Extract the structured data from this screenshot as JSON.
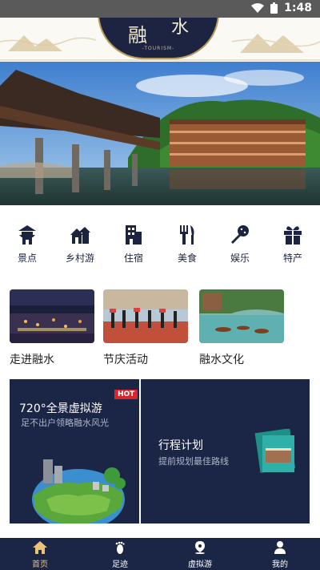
{
  "status_bar": {
    "time": "1:48"
  },
  "header": {
    "logo_char_1": "融",
    "logo_char_2": "水",
    "logo_sub": "-TOURISM-"
  },
  "categories": [
    {
      "label": "景点",
      "icon": "pagoda-icon"
    },
    {
      "label": "乡村游",
      "icon": "village-house-icon"
    },
    {
      "label": "住宿",
      "icon": "hotel-building-icon"
    },
    {
      "label": "美食",
      "icon": "fork-knife-icon"
    },
    {
      "label": "娱乐",
      "icon": "microphone-icon"
    },
    {
      "label": "特产",
      "icon": "gift-icon"
    }
  ],
  "tiles": [
    {
      "label": "走进融水"
    },
    {
      "label": "节庆活动"
    },
    {
      "label": "融水文化"
    }
  ],
  "promo_left": {
    "title": "720°全景虚拟游",
    "badge": "HOT",
    "subtitle": "足不出户领略融水风光"
  },
  "promo_right": {
    "title": "行程计划",
    "subtitle": "提前规划最佳路线"
  },
  "bottom_nav": [
    {
      "label": "首页",
      "icon": "home-icon",
      "active": true
    },
    {
      "label": "足迹",
      "icon": "footprint-icon",
      "active": false
    },
    {
      "label": "虚拟游",
      "icon": "location-pin-icon",
      "active": false
    },
    {
      "label": "我的",
      "icon": "user-icon",
      "active": false
    }
  ],
  "colors": {
    "navy": "#1b2546",
    "gold": "#e9c37a",
    "hot_red": "#d9262c"
  }
}
